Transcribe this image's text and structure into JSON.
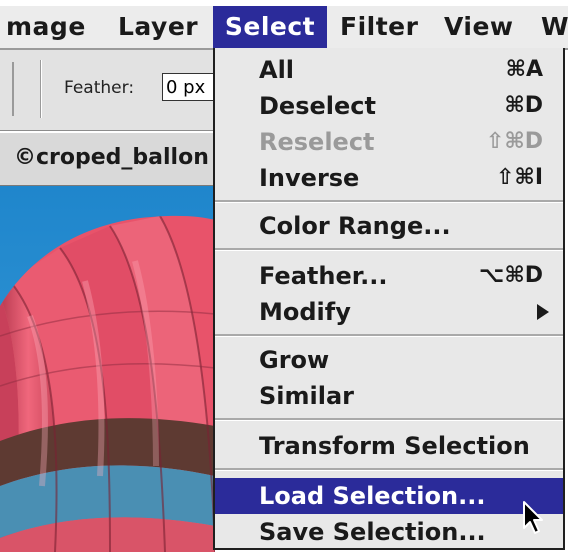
{
  "menubar": {
    "items": [
      {
        "label": "mage"
      },
      {
        "label": "Layer"
      },
      {
        "label": "Select",
        "active": true
      },
      {
        "label": "Filter"
      },
      {
        "label": "View"
      },
      {
        "label": "W"
      }
    ]
  },
  "options": {
    "feather_label": "Feather:",
    "feather_value": "0 px"
  },
  "document": {
    "title": "©croped_ballon"
  },
  "select_menu": {
    "groups": [
      [
        {
          "label": "All",
          "shortcut": "⌘A",
          "enabled": true
        },
        {
          "label": "Deselect",
          "shortcut": "⌘D",
          "enabled": true
        },
        {
          "label": "Reselect",
          "shortcut": "⇧⌘D",
          "enabled": false
        },
        {
          "label": "Inverse",
          "shortcut": "⇧⌘I",
          "enabled": true
        }
      ],
      [
        {
          "label": "Color Range...",
          "shortcut": "",
          "enabled": true
        }
      ],
      [
        {
          "label": "Feather...",
          "shortcut": "⌥⌘D",
          "enabled": true
        },
        {
          "label": "Modify",
          "shortcut": "",
          "enabled": true,
          "submenu": true
        }
      ],
      [
        {
          "label": "Grow",
          "shortcut": "",
          "enabled": true
        },
        {
          "label": "Similar",
          "shortcut": "",
          "enabled": true
        }
      ],
      [
        {
          "label": "Transform Selection",
          "shortcut": "",
          "enabled": true
        }
      ],
      [
        {
          "label": "Load Selection...",
          "shortcut": "",
          "enabled": true,
          "highlighted": true
        },
        {
          "label": "Save Selection...",
          "shortcut": "",
          "enabled": true
        }
      ]
    ]
  },
  "colors": {
    "menu_highlight": "#2b2b9a",
    "menu_background": "#e8e8e8",
    "disabled_text": "#9a9a9a",
    "sky": "#2a8ed0",
    "balloon_pink": "#e8536a",
    "balloon_brown": "#5e3a32",
    "balloon_blue": "#4a8fb3"
  },
  "icons": {
    "cursor": "arrow-cursor-icon",
    "submenu": "submenu-arrow-icon"
  }
}
